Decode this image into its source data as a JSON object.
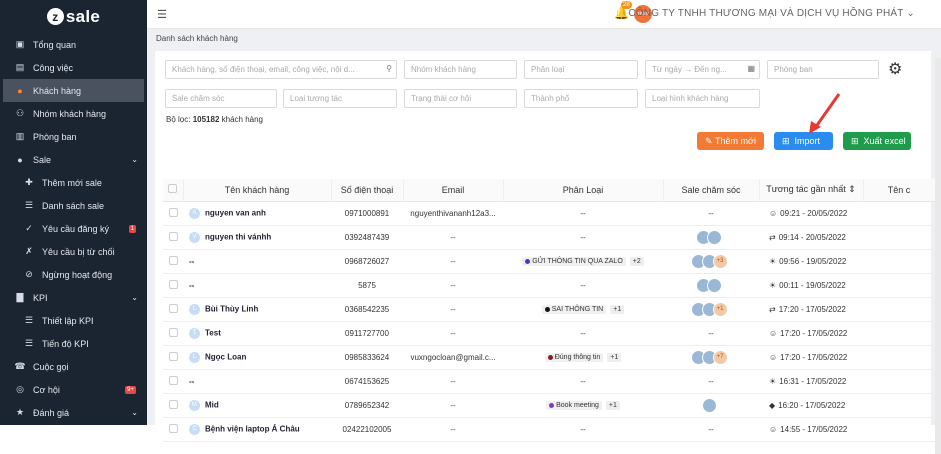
{
  "app": {
    "logo_text": "sale",
    "logo_letter": "z"
  },
  "sidebar": {
    "items": [
      {
        "label": "Tổng quan",
        "icon": "dashboard-icon"
      },
      {
        "label": "Công việc",
        "icon": "briefcase-icon"
      },
      {
        "label": "Khách hàng",
        "icon": "user-icon",
        "active": true
      },
      {
        "label": "Nhóm khách hàng",
        "icon": "users-icon"
      },
      {
        "label": "Phòng ban",
        "icon": "building-icon"
      },
      {
        "label": "Sale",
        "icon": "user-icon",
        "expandable": true
      },
      {
        "label": "Thêm mới sale",
        "icon": "user-plus-icon",
        "sub": true
      },
      {
        "label": "Danh sách sale",
        "icon": "list-icon",
        "sub": true
      },
      {
        "label": "Yêu cầu đăng ký",
        "icon": "user-check-icon",
        "sub": true,
        "badge": "1"
      },
      {
        "label": "Yêu cầu bị từ chối",
        "icon": "user-x-icon",
        "sub": true
      },
      {
        "label": "Ngừng hoạt động",
        "icon": "user-slash-icon",
        "sub": true
      },
      {
        "label": "KPI",
        "icon": "chart-icon",
        "expandable": true
      },
      {
        "label": "Thiết lập KPI",
        "icon": "list-icon",
        "sub": true
      },
      {
        "label": "Tiến độ KPI",
        "icon": "list-icon",
        "sub": true
      },
      {
        "label": "Cuộc gọi",
        "icon": "phone-icon"
      },
      {
        "label": "Cơ hội",
        "icon": "target-icon",
        "badge": "9+"
      },
      {
        "label": "Đánh giá",
        "icon": "star-icon",
        "expandable": true
      }
    ]
  },
  "topbar": {
    "company": "CÔNG TY TNHH THƯƠNG MẠI VÀ DỊCH VỤ HỒNG PHÁT",
    "notif_count": "28"
  },
  "breadcrumb": "Danh sách khách hàng",
  "filters": {
    "search": "Khách hàng, số điện thoại, email, công việc, nội d...",
    "group": "Nhóm khách hàng",
    "category": "Phân loại",
    "from_date": "Từ ngày",
    "to_date": "Đến ng...",
    "department": "Phòng ban",
    "sale": "Sale chăm sóc",
    "interaction": "Loại tương tác",
    "opportunity": "Trạng thái cơ hội",
    "city": "Thành phố",
    "customer_type": "Loại hình khách hàng",
    "filter_label": "Bộ lọc:",
    "filter_count": "105182",
    "filter_suffix": "khách hàng"
  },
  "buttons": {
    "add": "Thêm mới",
    "import": "Import",
    "export": "Xuất excel"
  },
  "table": {
    "headers": [
      "Tên khách hàng",
      "Số điện thoại",
      "Email",
      "Phân Loại",
      "Sale chăm sóc",
      "Tương tác gần nhất",
      "Tên c"
    ],
    "rows": [
      {
        "initial": "A",
        "name": "nguyen van anh",
        "phone": "0971000891",
        "email": "nguyenthivananh12a3...",
        "tag": "--",
        "tag_color": "",
        "plus": "",
        "sales": 0,
        "more": "",
        "time": "09:21 - 20/05/2022",
        "icon": "contact-icon"
      },
      {
        "initial": "V",
        "name": "nguyen thi vánhh",
        "phone": "0392487439",
        "email": "--",
        "tag": "--",
        "tag_color": "",
        "plus": "",
        "sales": 2,
        "more": "",
        "time": "09:14 - 20/05/2022",
        "icon": "transfer-icon"
      },
      {
        "initial": "",
        "name": "--",
        "phone": "0968726027",
        "email": "--",
        "tag": "GỬI THÔNG TIN QUA ZALO",
        "tag_color": "#5b2bd9",
        "plus": "+2",
        "sales": 2,
        "more": "+3",
        "time": "09:56 - 19/05/2022",
        "icon": "bulb-icon"
      },
      {
        "initial": "",
        "name": "--",
        "phone": "5875",
        "email": "--",
        "tag": "--",
        "tag_color": "",
        "plus": "",
        "sales": 2,
        "more": "",
        "time": "00:11 - 19/05/2022",
        "icon": "bulb-icon"
      },
      {
        "initial": "L",
        "name": "Bùi Thùy Linh",
        "phone": "0368542235",
        "email": "--",
        "tag": "SAI THÔNG TIN",
        "tag_color": "#111111",
        "plus": "+1",
        "sales": 2,
        "more": "+1",
        "time": "17:20 - 17/05/2022",
        "icon": "transfer-icon"
      },
      {
        "initial": "T",
        "name": "Test",
        "phone": "0911727700",
        "email": "--",
        "tag": "--",
        "tag_color": "",
        "plus": "",
        "sales": 0,
        "more": "",
        "time": "17:20 - 17/05/2022",
        "icon": "contact-icon"
      },
      {
        "initial": "L",
        "name": "Ngọc Loan",
        "phone": "0985833624",
        "email": "vuxngocloan@gmail.c...",
        "tag": "Đúng thông tin",
        "tag_color": "#8b1a1a",
        "plus": "+1",
        "sales": 2,
        "more": "+7",
        "time": "17:20 - 17/05/2022",
        "icon": "contact-icon"
      },
      {
        "initial": "",
        "name": "--",
        "phone": "0674153625",
        "email": "--",
        "tag": "--",
        "tag_color": "",
        "plus": "",
        "sales": 0,
        "more": "",
        "time": "16:31 - 17/05/2022",
        "icon": "bulb-icon"
      },
      {
        "initial": "M",
        "name": "Mid",
        "phone": "0789652342",
        "email": "--",
        "tag": "Book meeting",
        "tag_color": "#7b3fb3",
        "plus": "+1",
        "sales": 1,
        "more": "",
        "time": "16:20 - 17/05/2022",
        "icon": "tag-icon"
      },
      {
        "initial": "C",
        "name": "Bệnh viện laptop Á Châu",
        "phone": "02422102005",
        "email": "--",
        "tag": "--",
        "tag_color": "",
        "plus": "",
        "sales": 0,
        "more": "",
        "time": "14:55 - 17/05/2022",
        "icon": "contact-icon"
      }
    ]
  },
  "colors": {
    "sidebar": "#1b2431",
    "orange": "#f27a35",
    "blue": "#2b8cf0",
    "green": "#1f9b4c",
    "arrow": "#e53935"
  }
}
